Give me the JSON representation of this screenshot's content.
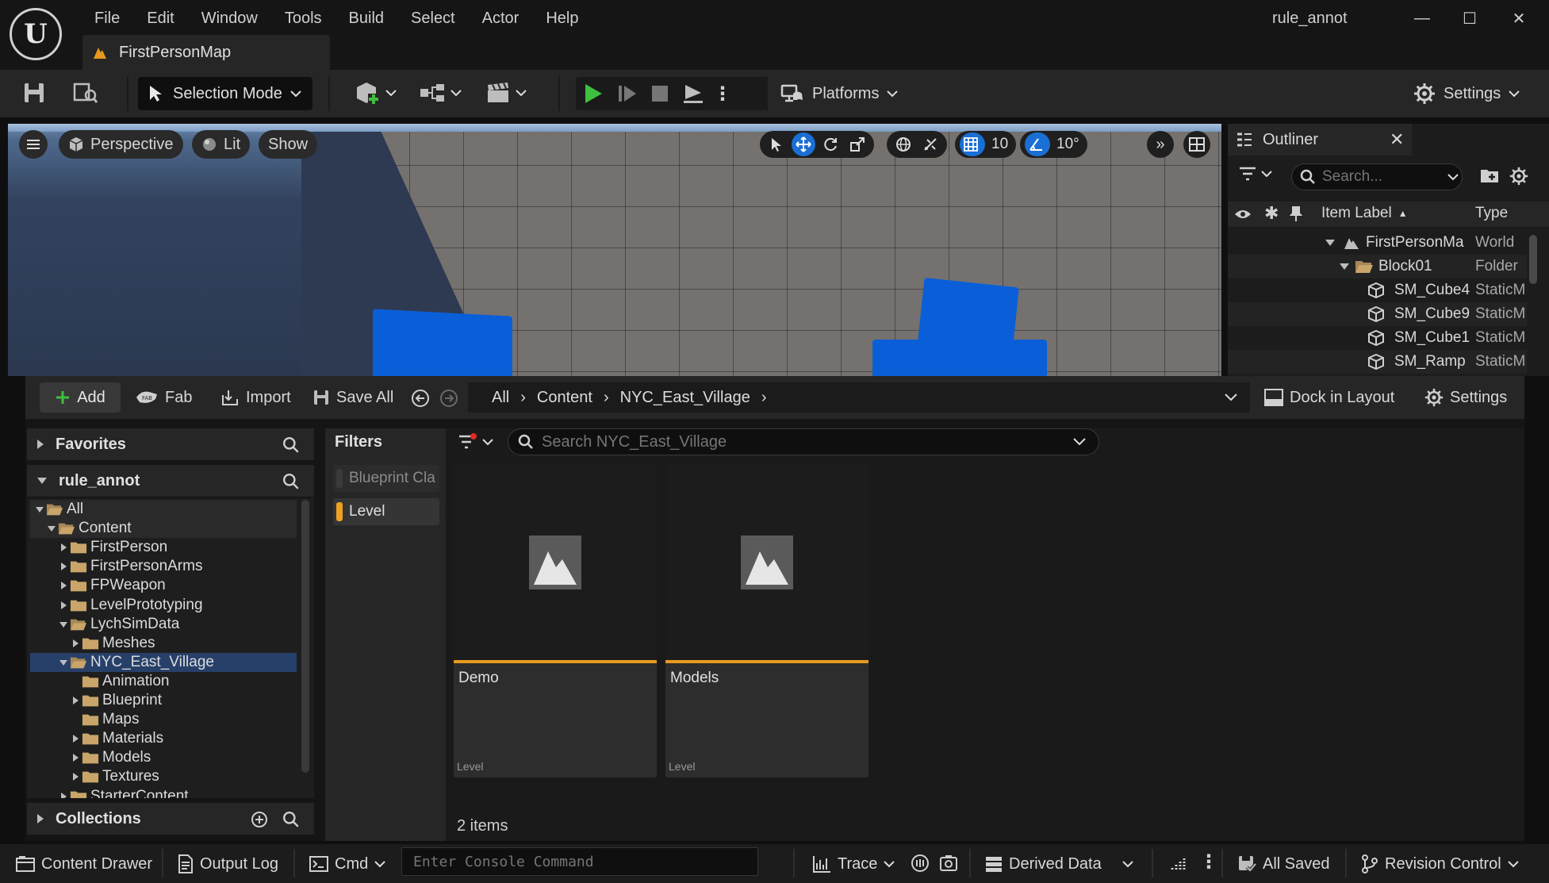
{
  "window": {
    "project_name": "rule_annot",
    "menu": [
      "File",
      "Edit",
      "Window",
      "Tools",
      "Build",
      "Select",
      "Actor",
      "Help"
    ],
    "document_tab": "FirstPersonMap",
    "controls": {
      "minimize": "—",
      "maximize": "☐",
      "close": "✕"
    }
  },
  "toolbar": {
    "selection_mode": "Selection Mode",
    "platforms": "Platforms",
    "settings": "Settings"
  },
  "viewport": {
    "perspective": "Perspective",
    "lit": "Lit",
    "show": "Show",
    "grid_size": "10",
    "rotation_snap": "10°"
  },
  "outliner": {
    "title": "Outliner",
    "search_placeholder": "Search...",
    "col_label": "Item Label",
    "col_type": "Type",
    "rows": [
      {
        "label": "FirstPersonMa",
        "type": "World"
      },
      {
        "label": "Block01",
        "type": "Folder"
      },
      {
        "label": "SM_Cube4",
        "type": "StaticM"
      },
      {
        "label": "SM_Cube9",
        "type": "StaticM"
      },
      {
        "label": "SM_Cube1",
        "type": "StaticM"
      },
      {
        "label": "SM_Ramp",
        "type": "StaticM"
      }
    ]
  },
  "content_browser": {
    "add": "Add",
    "fab": "Fab",
    "import": "Import",
    "save_all": "Save All",
    "breadcrumb": [
      "All",
      "Content",
      "NYC_East_Village"
    ],
    "dock_in_layout": "Dock in Layout",
    "settings": "Settings",
    "favorites": "Favorites",
    "project_root": "rule_annot",
    "collections": "Collections",
    "tree": [
      {
        "label": "All",
        "depth": 0,
        "expanded": true,
        "open": true
      },
      {
        "label": "Content",
        "depth": 1,
        "expanded": true,
        "open": true
      },
      {
        "label": "FirstPerson",
        "depth": 2,
        "expanded": false
      },
      {
        "label": "FirstPersonArms",
        "depth": 2,
        "expanded": false
      },
      {
        "label": "FPWeapon",
        "depth": 2,
        "expanded": false
      },
      {
        "label": "LevelPrototyping",
        "depth": 2,
        "expanded": false
      },
      {
        "label": "LychSimData",
        "depth": 2,
        "expanded": true,
        "open": true
      },
      {
        "label": "Meshes",
        "depth": 3,
        "expanded": false
      },
      {
        "label": "NYC_East_Village",
        "depth": 2,
        "expanded": true,
        "open": true,
        "selected": true
      },
      {
        "label": "Animation",
        "depth": 3,
        "leaf": true
      },
      {
        "label": "Blueprint",
        "depth": 3,
        "expanded": false
      },
      {
        "label": "Maps",
        "depth": 3,
        "leaf": true
      },
      {
        "label": "Materials",
        "depth": 3,
        "expanded": false
      },
      {
        "label": "Models",
        "depth": 3,
        "expanded": false
      },
      {
        "label": "Textures",
        "depth": 3,
        "expanded": false
      },
      {
        "label": "StarterContent",
        "depth": 2,
        "expanded": false
      }
    ],
    "filters_title": "Filters",
    "filters": [
      {
        "label": "Blueprint Cla",
        "active": false,
        "color": "#3a3a3a"
      },
      {
        "label": "Level",
        "active": true,
        "color": "#f0a020"
      }
    ],
    "search_placeholder": "Search NYC_East_Village",
    "assets": [
      {
        "name": "Demo",
        "kind": "Level"
      },
      {
        "name": "Models",
        "kind": "Level"
      }
    ],
    "item_count": "2 items"
  },
  "statusbar": {
    "content_drawer": "Content Drawer",
    "output_log": "Output Log",
    "cmd": "Cmd",
    "console_placeholder": "Enter Console Command",
    "trace": "Trace",
    "derived_data": "Derived Data",
    "all_saved": "All Saved",
    "revision_control": "Revision Control"
  },
  "colors": {
    "accent_blue": "#1a6fd4",
    "play_green": "#3fbf3f",
    "level_orange": "#e79a1f",
    "selection": "#27406a",
    "folder": "#c9a56a"
  }
}
